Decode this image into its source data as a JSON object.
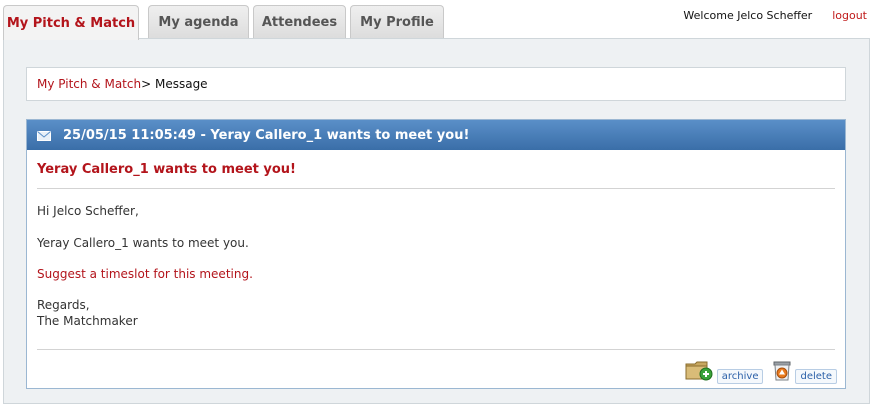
{
  "tabs": [
    {
      "label": "My Pitch & Match",
      "active": true
    },
    {
      "label": "My agenda",
      "active": false
    },
    {
      "label": "Attendees",
      "active": false
    },
    {
      "label": "My Profile",
      "active": false
    }
  ],
  "topbar": {
    "welcome": "Welcome Jelco Scheffer",
    "logout": "logout"
  },
  "breadcrumb": {
    "link": "My Pitch & Match",
    "separator": ">",
    "current": " Message"
  },
  "message": {
    "header": "25/05/15 11:05:49 - Yeray Callero_1 wants to meet you!",
    "subject": "Yeray Callero_1 wants to meet you!",
    "greeting": "Hi Jelco Scheffer,",
    "body": "Yeray Callero_1 wants to meet you.",
    "suggest_link": "Suggest a timeslot for this meeting.",
    "closing": "Regards,",
    "signature": "The Matchmaker"
  },
  "actions": {
    "archive": "archive",
    "delete": "delete"
  },
  "icons": {
    "header": "envelope-icon",
    "archive": "archive-folder-icon",
    "delete": "trash-icon"
  },
  "colors": {
    "accent_red": "#b3141b",
    "header_blue": "#3a6ea8",
    "link_blue": "#2a5fa8"
  }
}
